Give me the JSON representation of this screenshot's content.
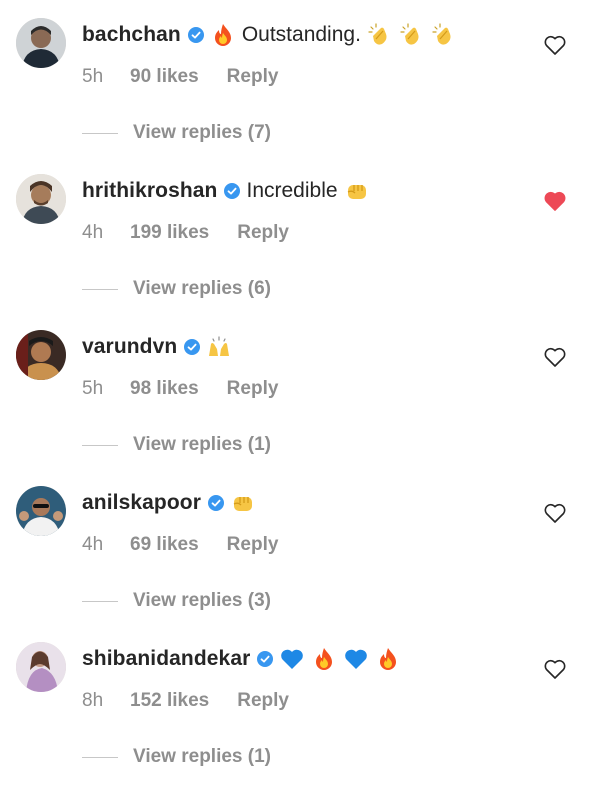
{
  "comments": [
    {
      "username": "bachchan",
      "text": "Outstanding.",
      "emojis_before": [
        "fire-emoji"
      ],
      "emojis_after": [
        "clapping-hands-emoji",
        "clapping-hands-emoji",
        "clapping-hands-emoji"
      ],
      "time": "5h",
      "likes": "90 likes",
      "reply": "Reply",
      "view_replies": "View replies (7)",
      "liked": false
    },
    {
      "username": "hrithikroshan",
      "text": "Incredible",
      "emojis_before": [],
      "emojis_after": [
        "oncoming-fist-emoji"
      ],
      "time": "4h",
      "likes": "199 likes",
      "reply": "Reply",
      "view_replies": "View replies (6)",
      "liked": true
    },
    {
      "username": "varundvn",
      "text": "",
      "emojis_before": [],
      "emojis_after": [
        "raising-hands-emoji"
      ],
      "time": "5h",
      "likes": "98 likes",
      "reply": "Reply",
      "view_replies": "View replies (1)",
      "liked": false
    },
    {
      "username": "anilskapoor",
      "text": "",
      "emojis_before": [],
      "emojis_after": [
        "oncoming-fist-emoji"
      ],
      "time": "4h",
      "likes": "69 likes",
      "reply": "Reply",
      "view_replies": "View replies (3)",
      "liked": false
    },
    {
      "username": "shibanidandekar",
      "text": "",
      "emojis_before": [],
      "emojis_after": [
        "blue-heart-emoji",
        "fire-emoji",
        "blue-heart-emoji",
        "fire-emoji"
      ],
      "time": "8h",
      "likes": "152 likes",
      "reply": "Reply",
      "view_replies": "View replies (1)",
      "liked": false
    }
  ],
  "colors": {
    "text": "#262626",
    "secondary": "#8e8e8e",
    "verified": "#3897f0",
    "liked_heart": "#ed4956"
  }
}
